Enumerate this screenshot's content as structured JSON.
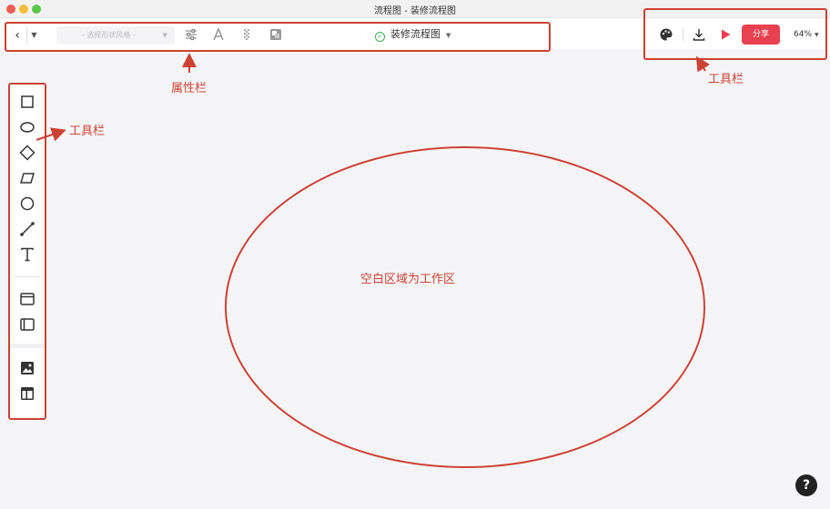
{
  "window": {
    "title": "流程图 - 装修流程图"
  },
  "toolbar": {
    "back_icon": "chevron-left-icon",
    "style_select_placeholder": "- 选择形状风格 -",
    "doc_title": "装修流程图",
    "share_label": "分享",
    "zoom_value": "64%"
  },
  "left_toolbar": {
    "tools": [
      "rectangle-icon",
      "ellipse-icon",
      "diamond-icon",
      "parallelogram-icon",
      "circle-icon",
      "line-icon",
      "text-icon",
      "container-icon",
      "swimlane-icon",
      "image-icon",
      "table-icon"
    ]
  },
  "annotations": {
    "property_bar_label": "属性栏",
    "right_toolbar_label": "工具栏",
    "left_toolbar_label": "工具栏",
    "workspace_label": "空白区域为工作区"
  },
  "help": {
    "label": "?"
  },
  "colors": {
    "annotation": "#cc4233",
    "share": "#e8414f",
    "saved": "#3dae5a"
  }
}
